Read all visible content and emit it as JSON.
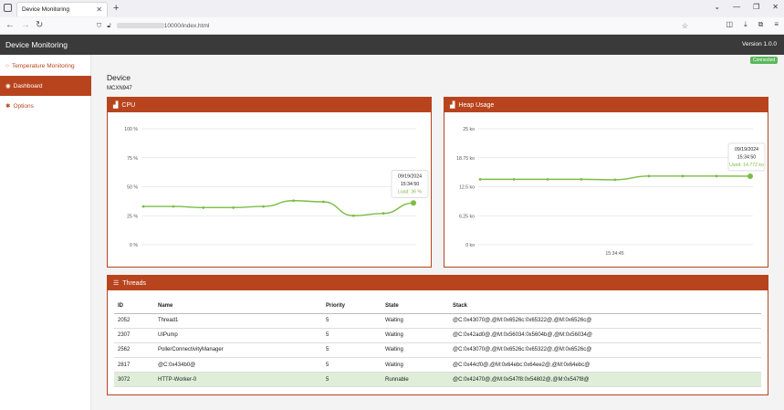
{
  "browser": {
    "tab_title": "Device Monitoring",
    "url": "10000/index.html"
  },
  "header": {
    "title": "Device Monitoring",
    "version": "Version 1.0.0",
    "status": "Connected"
  },
  "sidebar": {
    "items": [
      {
        "label": "Temperature Monitoring",
        "icon": "circle-icon",
        "active": false
      },
      {
        "label": "Dashboard",
        "icon": "dashboard-icon",
        "active": true
      },
      {
        "label": "Options",
        "icon": "gear-icon",
        "active": false
      }
    ]
  },
  "device": {
    "heading": "Device",
    "id": "MCXN947"
  },
  "cpu_panel": {
    "title": "CPU",
    "tooltip": {
      "date": "09/19/2024",
      "time": "15:34:50",
      "value": "Load: 36 %"
    }
  },
  "heap_panel": {
    "title": "Heap Usage",
    "x_tick": "15:34:45",
    "tooltip": {
      "date": "09/19/2024",
      "time": "15:34:50",
      "value": "Used: 14.772 ko"
    }
  },
  "colors": {
    "accent": "#b8441e",
    "series": "#7cbd45",
    "highlight_row": "#dfeed8",
    "header_bg": "#3a3a3a"
  },
  "chart_data": [
    {
      "type": "line",
      "title": "CPU",
      "yticks": [
        "0 %",
        "25 %",
        "50 %",
        "75 %",
        "100 %"
      ],
      "ylim": [
        0,
        100
      ],
      "x": [
        1,
        2,
        3,
        4,
        5,
        6,
        7,
        8,
        9,
        10
      ],
      "series": [
        {
          "values": [
            33,
            33,
            32,
            32,
            33,
            38,
            37,
            25,
            27,
            36
          ]
        }
      ]
    },
    {
      "type": "line",
      "title": "Heap Usage",
      "yticks": [
        "0 ko",
        "6.25 ko",
        "12.5 ko",
        "18.75 ko",
        "25 ko"
      ],
      "ylim": [
        0,
        25
      ],
      "x": [
        1,
        2,
        3,
        4,
        5,
        6,
        7,
        8,
        9
      ],
      "series": [
        {
          "values": [
            14.1,
            14.1,
            14.1,
            14.1,
            14.0,
            14.8,
            14.8,
            14.8,
            14.772
          ]
        }
      ]
    }
  ],
  "threads": {
    "title": "Threads",
    "columns": [
      "ID",
      "Name",
      "Priority",
      "State",
      "Stack"
    ],
    "rows": [
      [
        "2052",
        "Thread1",
        "5",
        "Waiting",
        "@C:0x43070@,@M:0x6526c:0x65322@,@M:0x6526c@"
      ],
      [
        "2307",
        "UIPump",
        "5",
        "Waiting",
        "@C:0x42ad0@,@M:0x56034:0x5604b@,@M:0x56034@"
      ],
      [
        "2562",
        "PollerConnectivityManager",
        "5",
        "Waiting",
        "@C:0x43070@,@M:0x6526c:0x65322@,@M:0x6526c@"
      ],
      [
        "2817",
        "@C:0x434b0@",
        "5",
        "Waiting",
        "@C:0x44cf0@,@M:0x64ebc:0x64ee2@,@M:0x64ebc@"
      ],
      [
        "3072",
        "HTTP-Worker-0",
        "5",
        "Runnable",
        "@C:0x42470@,@M:0x547f8:0x54802@,@M:0x547f8@"
      ]
    ]
  }
}
